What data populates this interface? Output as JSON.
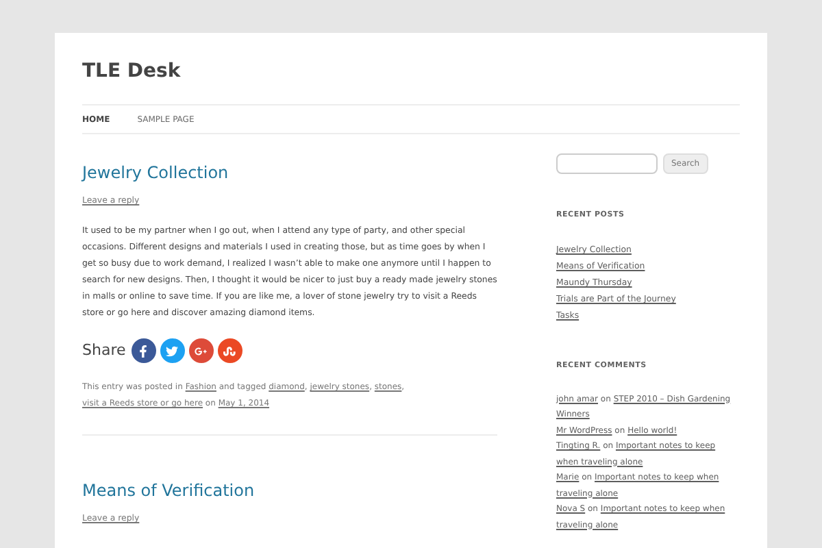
{
  "site": {
    "title": "TLE Desk"
  },
  "nav": [
    {
      "label": "HOME",
      "selected": true
    },
    {
      "label": "SAMPLE PAGE",
      "selected": false
    }
  ],
  "posts": [
    {
      "title": "Jewelry Collection",
      "reply": "Leave a reply",
      "body": "It used to be my partner when I go out, when I attend any type of party, and other special occasions. Different designs and materials I used in creating those, but as time goes by when I get so busy due to work demand, I realized I wasn’t able to make one anymore until I happen to search for new designs. Then, I thought it would be nicer to just buy a ready made jewelry stones in malls or online to save time. If you are like me, a lover of stone jewelry try to visit a Reeds store or go here and discover amazing diamond items.",
      "share_label": "Share",
      "share": [
        {
          "kind": "facebook",
          "color": "#3b5998"
        },
        {
          "kind": "twitter",
          "color": "#1da1f2"
        },
        {
          "kind": "googleplus",
          "color": "#dd4b39"
        },
        {
          "kind": "stumbleupon",
          "color": "#eb4924"
        }
      ],
      "meta": [
        {
          "kind": "text",
          "text": "This entry was posted in "
        },
        {
          "kind": "link",
          "text": "Fashion"
        },
        {
          "kind": "text",
          "text": " and tagged "
        },
        {
          "kind": "link",
          "text": "diamond"
        },
        {
          "kind": "text",
          "text": ", "
        },
        {
          "kind": "link",
          "text": "jewelry stones"
        },
        {
          "kind": "text",
          "text": ", "
        },
        {
          "kind": "link",
          "text": "stones"
        },
        {
          "kind": "text",
          "text": ", "
        },
        {
          "kind": "link",
          "text": "visit a Reeds store or go here"
        },
        {
          "kind": "text",
          "text": " on "
        },
        {
          "kind": "link",
          "text": "May 1, 2014"
        }
      ]
    },
    {
      "title": "Means of Verification",
      "reply": "Leave a reply"
    }
  ],
  "search": {
    "button": "Search"
  },
  "recent_posts": {
    "heading": "RECENT POSTS",
    "items": [
      "Jewelry Collection",
      "Means of Verification",
      "Maundy Thursday",
      "Trials are Part of the Journey",
      "Tasks"
    ]
  },
  "recent_comments": {
    "heading": "RECENT COMMENTS",
    "items": [
      {
        "author": "john amar",
        "on": "on",
        "post": "STEP 2010 – Dish Gardening",
        "post_2": "Winners"
      },
      {
        "author": "Mr WordPress",
        "on": "on",
        "post": "Hello world!"
      },
      {
        "author": "Tingting R.",
        "on": "on",
        "post": "Important notes to keep",
        "post_2": "when traveling alone"
      },
      {
        "author": "Marie",
        "on": "on",
        "post": "Important notes to keep when",
        "post_2": "traveling alone"
      },
      {
        "author": "Nova S",
        "on": "on",
        "post": "Important notes to keep when",
        "post_2": "traveling alone"
      }
    ]
  }
}
